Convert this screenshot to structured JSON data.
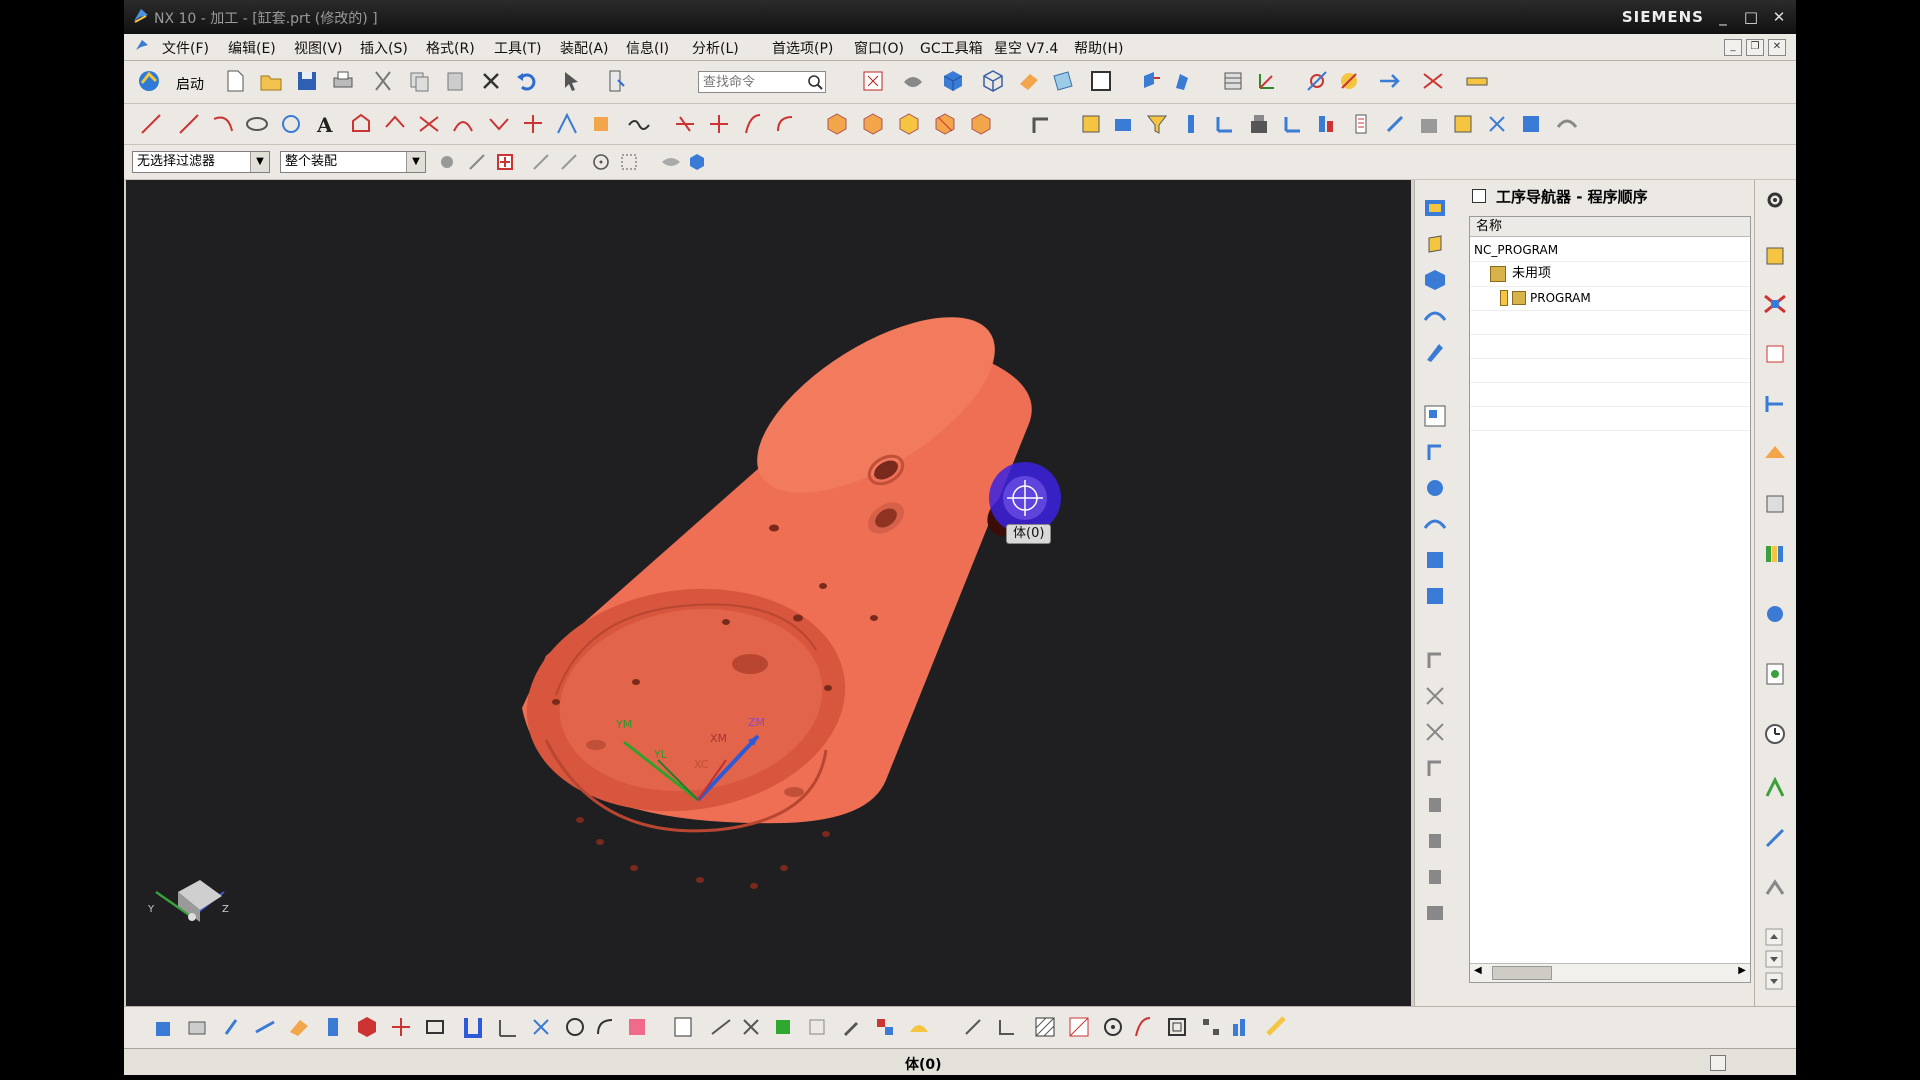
{
  "window": {
    "title": "NX 10 - 加工 - [缸套.prt  (修改的) ]",
    "brand": "SIEMENS",
    "controls": [
      "_",
      "□",
      "✕"
    ]
  },
  "menu": {
    "items": [
      "文件(F)",
      "编辑(E)",
      "视图(V)",
      "插入(S)",
      "格式(R)",
      "工具(T)",
      "装配(A)",
      "信息(I)",
      "分析(L)",
      "首选项(P)",
      "窗口(O)",
      "GC工具箱",
      "星空 V7.4",
      "帮助(H)"
    ]
  },
  "toolbar": {
    "start_label": "启动",
    "search_placeholder": "查找命令"
  },
  "selection": {
    "filter_value": "无选择过滤器",
    "scope_value": "整个装配"
  },
  "viewport": {
    "tooltip": "体(0)",
    "background_color": "#1f1f22",
    "part_color": "#ef6f54",
    "axis_labels": [
      "YM",
      "YL",
      "XM",
      "XC",
      "ZM"
    ],
    "triad_labels": [
      "Y",
      "Z"
    ]
  },
  "navigator": {
    "title": "工序导航器 - 程序顺序",
    "column_header": "名称",
    "rows": [
      "NC_PROGRAM",
      "未用项",
      "PROGRAM"
    ]
  },
  "status": {
    "text": "体(0)"
  }
}
